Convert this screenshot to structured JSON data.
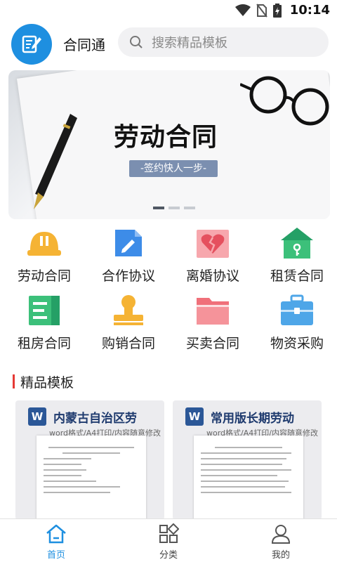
{
  "status_bar": {
    "time": "10:14",
    "icons": [
      "wifi-icon",
      "no-sim-icon",
      "battery-charging-icon"
    ]
  },
  "header": {
    "app_name": "合同通",
    "search_placeholder": "搜索精品模板"
  },
  "banner": {
    "title": "劳动合同",
    "subtitle": "-签约快人一步-",
    "slide_count": 3,
    "active_slide": 1
  },
  "categories": [
    {
      "label": "劳动合同",
      "icon": "hard-hat-icon",
      "color": "#f5b334"
    },
    {
      "label": "合作协议",
      "icon": "edit-document-icon",
      "color": "#3d8ce8"
    },
    {
      "label": "离婚协议",
      "icon": "broken-heart-icon",
      "color": "#f07a80"
    },
    {
      "label": "租赁合同",
      "icon": "house-key-icon",
      "color": "#25a066"
    },
    {
      "label": "租房合同",
      "icon": "document-list-icon",
      "color": "#3cc07a"
    },
    {
      "label": "购销合同",
      "icon": "stamp-icon",
      "color": "#f5b334"
    },
    {
      "label": "买卖合同",
      "icon": "folder-icon",
      "color": "#f0707a"
    },
    {
      "label": "物资采购",
      "icon": "briefcase-icon",
      "color": "#4ea6e8"
    }
  ],
  "section": {
    "title": "精品模板"
  },
  "templates": [
    {
      "title": "内蒙古自治区劳",
      "meta": "word格式/A4打印/内容随意修改",
      "badge": "W"
    },
    {
      "title": "常用版长期劳动",
      "meta": "word格式/A4打印/内容随意修改",
      "badge": "W"
    }
  ],
  "tabbar": [
    {
      "label": "首页",
      "icon": "home-icon",
      "active": true
    },
    {
      "label": "分类",
      "icon": "grid-icon",
      "active": false
    },
    {
      "label": "我的",
      "icon": "user-icon",
      "active": false
    }
  ],
  "colors": {
    "accent": "#1e8fe0",
    "section_bar": "#e53935"
  }
}
